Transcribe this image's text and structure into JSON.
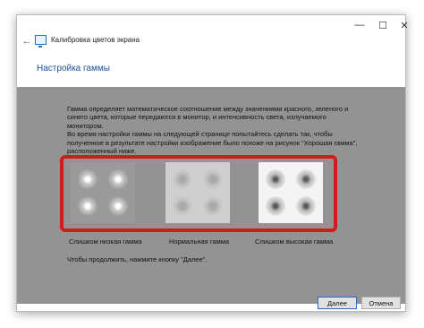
{
  "window": {
    "title": "Калибровка цветов экрана",
    "controls": {
      "minimize": "—",
      "maximize": "☐",
      "close": "✕"
    }
  },
  "header": {
    "title": "Настройка гаммы"
  },
  "description": {
    "line1": "Гамма определяет математическое соотношение между значениями красного, зеленого и синего цвета, которые передаются в монитор, и интенсивность света, излучаемого монитором.",
    "line2": "Во время настройки гаммы на следующей странице попытайтесь сделать так, чтобы полученное в результате настройки изображение было похоже на рисунок \"Хорошая гамма\", расположенный ниже."
  },
  "samples": [
    {
      "caption": "Слишком низкая гамма"
    },
    {
      "caption": "Нормальная гамма"
    },
    {
      "caption": "Слишком высокая гамма"
    }
  ],
  "instructions": "Чтобы продолжить, нажмите кнопку \"Далее\".",
  "buttons": {
    "next": "Далее",
    "cancel": "Отмена"
  },
  "colors": {
    "accent": "#1b4f9c",
    "highlight_frame": "#d41b1b",
    "background_gray": "#939393"
  }
}
